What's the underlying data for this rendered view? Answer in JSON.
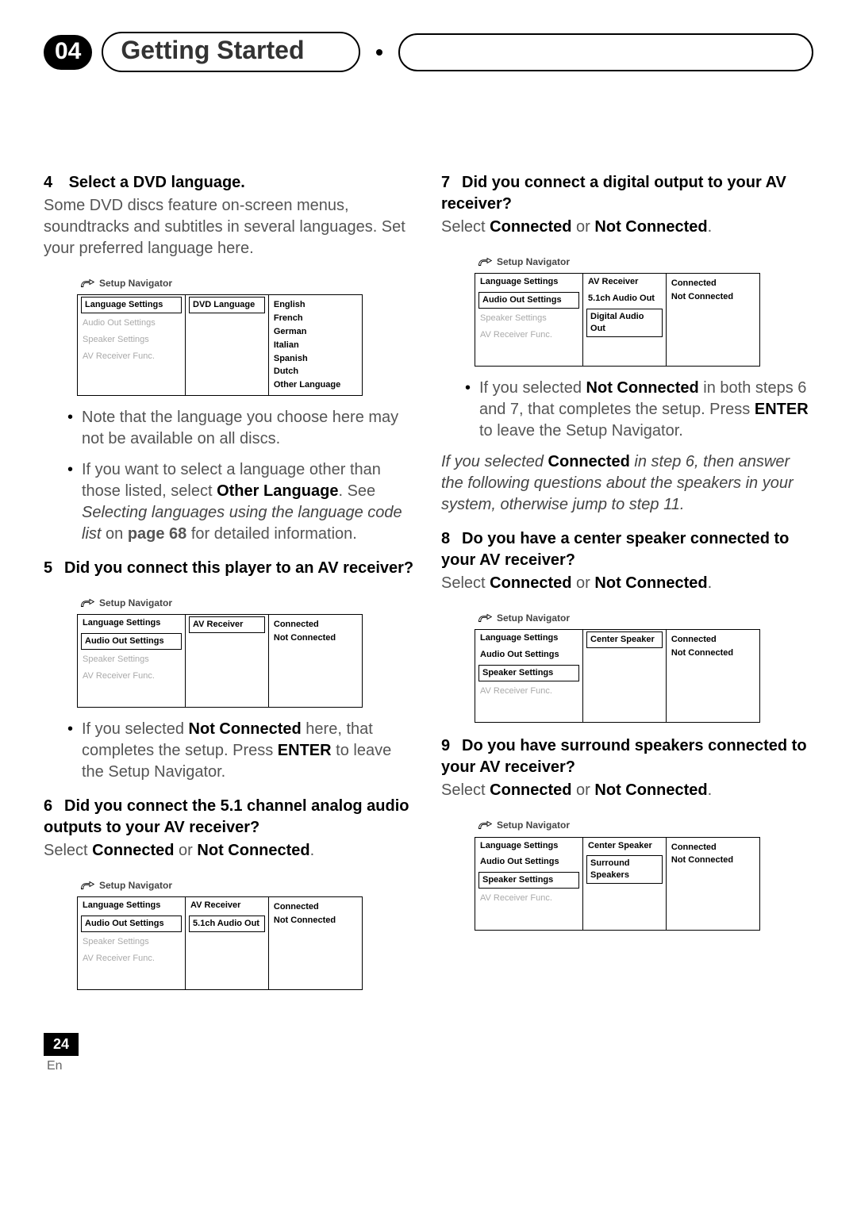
{
  "header": {
    "chapter": "04",
    "title": "Getting Started"
  },
  "left": {
    "step4": {
      "num": "4",
      "title": "Select a DVD language.",
      "body": "Some DVD discs feature on-screen menus, soundtracks and subtitles in several languages. Set your preferred language here.",
      "nav": {
        "title": "Setup Navigator",
        "left": [
          "Language Settings",
          "Audio Out Settings",
          "Speaker Settings",
          "AV Receiver Func."
        ],
        "leftActive": 0,
        "mid": [
          "DVD Language"
        ],
        "right": [
          "English",
          "French",
          "German",
          "Italian",
          "Spanish",
          "Dutch",
          "Other Language"
        ]
      },
      "bullet1": "Note that the language you choose here may not be available on all discs.",
      "bullet2a": "If you want to select a language other than those listed, select ",
      "bullet2b_bold": "Other Language",
      "bullet2c": ". See ",
      "bullet2d_italic": "Selecting languages using the language code list",
      "bullet2e": " on ",
      "bullet2f_bold": "page 68",
      "bullet2g": " for detailed information."
    },
    "step5": {
      "num": "5",
      "title": "Did you connect this player to an AV receiver?",
      "nav": {
        "title": "Setup Navigator",
        "left": [
          "Language Settings",
          "Audio Out Settings",
          "Speaker Settings",
          "AV Receiver Func."
        ],
        "leftActive": 1,
        "mid": [
          "AV Receiver"
        ],
        "right": [
          "Connected",
          "Not Connected"
        ]
      },
      "bullet1a": "If you selected ",
      "bullet1b_bold": "Not Connected",
      "bullet1c": " here, that completes the setup. Press ",
      "bullet1d_bold": "ENTER",
      "bullet1e": " to leave the Setup Navigator."
    },
    "step6": {
      "num": "6",
      "title": "Did you connect the 5.1 channel analog audio outputs to your AV receiver?",
      "select_a": "Select ",
      "select_b": "Connected",
      "select_c": " or ",
      "select_d": "Not Connected",
      "select_e": ".",
      "nav": {
        "title": "Setup Navigator",
        "left": [
          "Language Settings",
          "Audio Out Settings",
          "Speaker Settings",
          "AV Receiver Func."
        ],
        "leftActive": 1,
        "mid": [
          "AV Receiver",
          "5.1ch Audio Out"
        ],
        "right": [
          "Connected",
          "Not Connected"
        ]
      }
    }
  },
  "right": {
    "step7": {
      "num": "7",
      "title": "Did you connect a digital output to your AV receiver?",
      "select_a": "Select ",
      "select_b": "Connected",
      "select_c": " or ",
      "select_d": "Not Connected",
      "select_e": ".",
      "nav": {
        "title": "Setup Navigator",
        "left": [
          "Language Settings",
          "Audio Out Settings",
          "Speaker Settings",
          "AV Receiver Func."
        ],
        "leftActive": 1,
        "mid": [
          "AV Receiver",
          "5.1ch Audio Out",
          "Digital Audio Out"
        ],
        "right": [
          "Connected",
          "Not Connected"
        ]
      },
      "bullet1a": "If you selected ",
      "bullet1b_bold": "Not Connected",
      "bullet1c": " in both steps 6 and 7, that completes the setup. Press ",
      "bullet1d_bold": "ENTER",
      "bullet1e": " to leave the Setup Navigator.",
      "note_a": "If you selected ",
      "note_b_bold": "Connected",
      "note_c": " in step 6, then answer the following questions about the speakers in your system, otherwise jump to step 11."
    },
    "step8": {
      "num": "8",
      "title": "Do you have a center speaker connected to your AV receiver?",
      "select_a": "Select ",
      "select_b": "Connected",
      "select_c": " or ",
      "select_d": "Not Connected",
      "select_e": ".",
      "nav": {
        "title": "Setup Navigator",
        "left": [
          "Language Settings",
          "Audio Out Settings",
          "Speaker Settings",
          "AV Receiver Func."
        ],
        "leftActive": 2,
        "mid": [
          "Center Speaker"
        ],
        "right": [
          "Connected",
          "Not Connected"
        ]
      }
    },
    "step9": {
      "num": "9",
      "title": "Do you have surround speakers connected to your AV receiver?",
      "select_a": "Select ",
      "select_b": "Connected",
      "select_c": " or ",
      "select_d": "Not Connected",
      "select_e": ".",
      "nav": {
        "title": "Setup Navigator",
        "left": [
          "Language Settings",
          "Audio Out Settings",
          "Speaker Settings",
          "AV Receiver Func."
        ],
        "leftActive": 2,
        "mid": [
          "Center Speaker",
          "Surround Speakers"
        ],
        "right": [
          "Connected",
          "Not Connected"
        ]
      }
    }
  },
  "footer": {
    "page": "24",
    "lang": "En"
  }
}
